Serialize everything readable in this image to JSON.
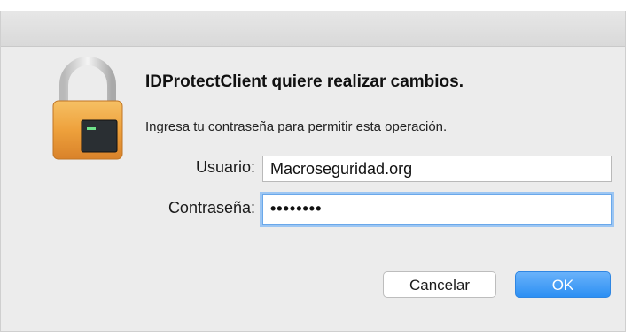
{
  "dialog": {
    "heading": "IDProtectClient quiere realizar cambios.",
    "message": "Ingresa tu contraseña para permitir esta operación.",
    "fields": {
      "username_label": "Usuario:",
      "username_value": "Macroseguridad.org",
      "password_label": "Contraseña:",
      "password_mask": "••••••••"
    },
    "buttons": {
      "cancel_label": "Cancelar",
      "ok_label": "OK"
    },
    "icon": "lock-icon",
    "colors": {
      "accent": "#2c8ff3",
      "focus_ring": "#9cc6f3"
    }
  }
}
